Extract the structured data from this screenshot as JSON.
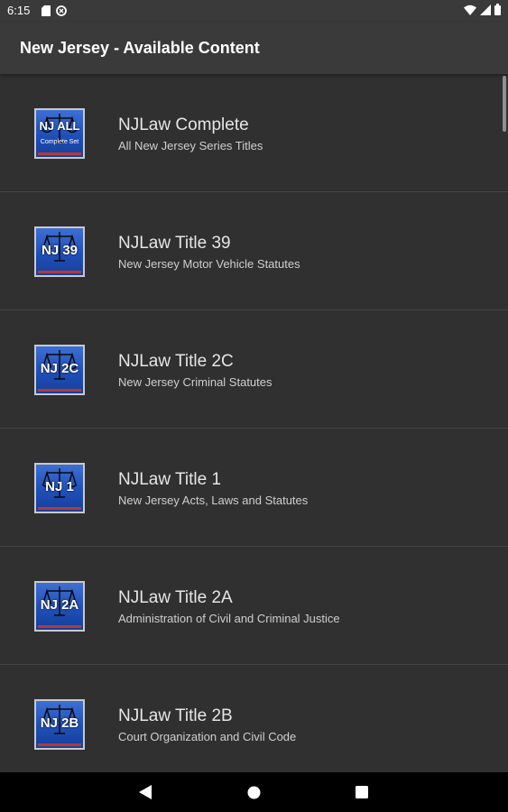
{
  "status_bar": {
    "time": "6:15",
    "left_icons": [
      "sd-card-icon",
      "sync-icon"
    ],
    "right_icons": [
      "wifi-icon",
      "signal-icon",
      "battery-icon"
    ]
  },
  "app_bar": {
    "title": "New Jersey - Available Content"
  },
  "items": [
    {
      "icon_label": "NJ ALL",
      "icon_sublabel": "Complete Set",
      "title": "NJLaw Complete",
      "subtitle": "All New Jersey Series Titles"
    },
    {
      "icon_label": "NJ 39",
      "icon_sublabel": "",
      "title": "NJLaw Title 39",
      "subtitle": "New Jersey Motor Vehicle Statutes"
    },
    {
      "icon_label": "NJ 2C",
      "icon_sublabel": "",
      "title": "NJLaw Title 2C",
      "subtitle": "New Jersey Criminal Statutes"
    },
    {
      "icon_label": "NJ 1",
      "icon_sublabel": "",
      "title": "NJLaw Title 1",
      "subtitle": "New Jersey Acts, Laws and Statutes"
    },
    {
      "icon_label": "NJ 2A",
      "icon_sublabel": "",
      "title": "NJLaw Title 2A",
      "subtitle": "Administration of Civil and Criminal Justice"
    },
    {
      "icon_label": "NJ 2B",
      "icon_sublabel": "",
      "title": "NJLaw Title 2B",
      "subtitle": "Court Organization and Civil Code"
    }
  ],
  "nav_bar": {
    "buttons": [
      "back-icon",
      "home-icon",
      "recents-icon"
    ]
  },
  "colors": {
    "background": "#303030",
    "app_bar": "#3a3a3a",
    "icon_blue": "#1f4fb8"
  }
}
